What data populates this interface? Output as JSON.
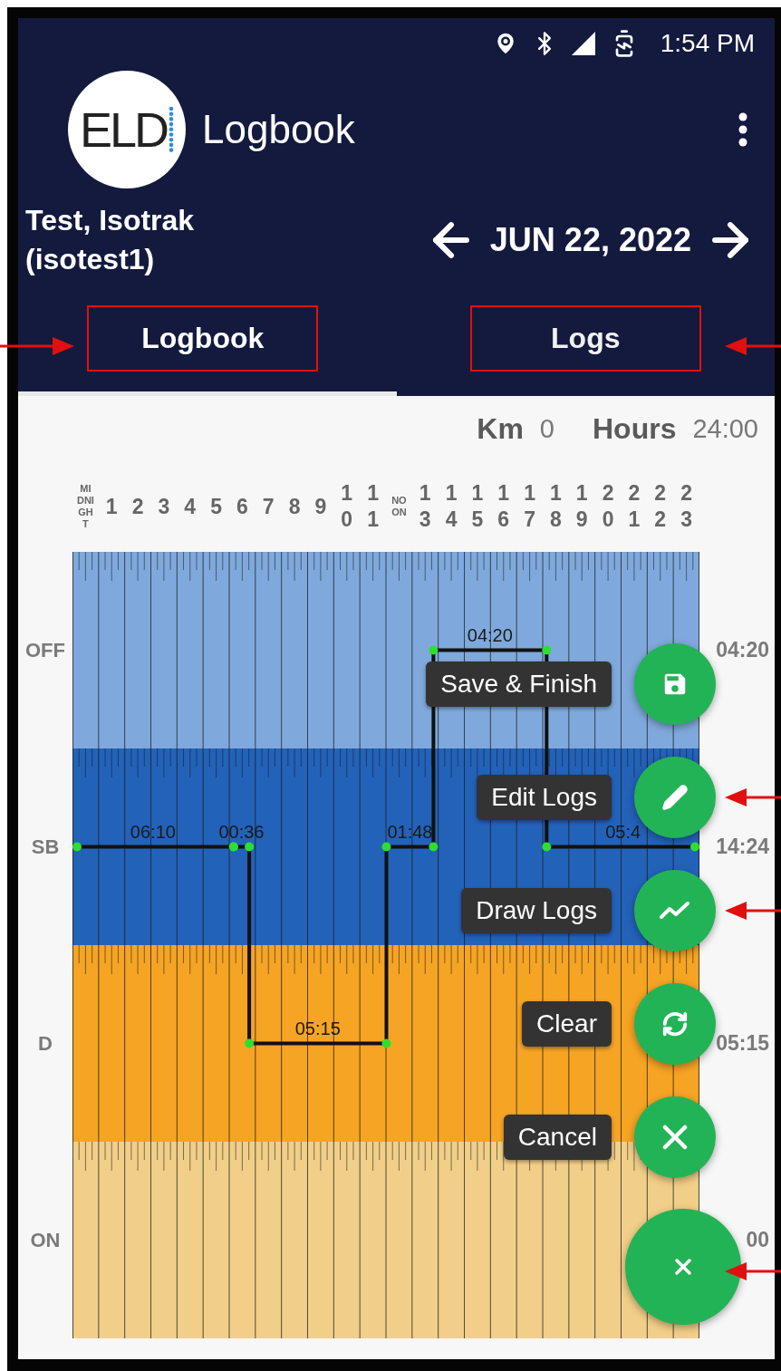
{
  "status_bar": {
    "time": "1:54 PM"
  },
  "app_bar": {
    "logo_text": "ELD",
    "title": "Logbook"
  },
  "driver": {
    "name": "Test, Isotrak",
    "username": "(isotest1)"
  },
  "date_nav": {
    "date": "JUN 22, 2022"
  },
  "tabs": [
    {
      "label": "Logbook",
      "selected": true
    },
    {
      "label": "Logs",
      "selected": false
    }
  ],
  "summary": {
    "km_label": "Km",
    "km_value": "0",
    "hours_label": "Hours",
    "hours_value": "24:00"
  },
  "hour_labels": [
    {
      "text": "MIDNIGHT",
      "kind": "word"
    },
    {
      "text": "1",
      "kind": "number"
    },
    {
      "text": "2",
      "kind": "number"
    },
    {
      "text": "3",
      "kind": "number"
    },
    {
      "text": "4",
      "kind": "number"
    },
    {
      "text": "5",
      "kind": "number"
    },
    {
      "text": "6",
      "kind": "number"
    },
    {
      "text": "7",
      "kind": "number"
    },
    {
      "text": "8",
      "kind": "number"
    },
    {
      "text": "9",
      "kind": "number"
    },
    {
      "text": "10",
      "kind": "number"
    },
    {
      "text": "11",
      "kind": "number"
    },
    {
      "text": "NOON",
      "kind": "word"
    },
    {
      "text": "13",
      "kind": "number"
    },
    {
      "text": "14",
      "kind": "number"
    },
    {
      "text": "15",
      "kind": "number"
    },
    {
      "text": "16",
      "kind": "number"
    },
    {
      "text": "17",
      "kind": "number"
    },
    {
      "text": "18",
      "kind": "number"
    },
    {
      "text": "19",
      "kind": "number"
    },
    {
      "text": "20",
      "kind": "number"
    },
    {
      "text": "21",
      "kind": "number"
    },
    {
      "text": "22",
      "kind": "number"
    },
    {
      "text": "23",
      "kind": "number"
    }
  ],
  "rows": [
    {
      "kind": "off",
      "label": "OFF",
      "total": "04:20"
    },
    {
      "kind": "sb",
      "label": "SB",
      "total": "14:24"
    },
    {
      "kind": "d",
      "label": "D",
      "total": "05:15"
    },
    {
      "kind": "on",
      "label": "ON",
      "total": "00"
    }
  ],
  "segments": [
    {
      "kind": "sb",
      "label": "06:10"
    },
    {
      "kind": "sb",
      "label": "00:36"
    },
    {
      "kind": "d",
      "label": "05:15"
    },
    {
      "kind": "sb",
      "label": "01:48"
    },
    {
      "kind": "off",
      "label": "04:20"
    },
    {
      "kind": "sb",
      "label": "05:4"
    }
  ],
  "fab_menu_open": true,
  "fab_menu": [
    {
      "kind": "save",
      "label": "Save & Finish"
    },
    {
      "kind": "edit",
      "label": "Edit Logs"
    },
    {
      "kind": "draw",
      "label": "Draw Logs"
    },
    {
      "kind": "clear",
      "label": "Clear"
    },
    {
      "kind": "cancel",
      "label": "Cancel"
    }
  ]
}
